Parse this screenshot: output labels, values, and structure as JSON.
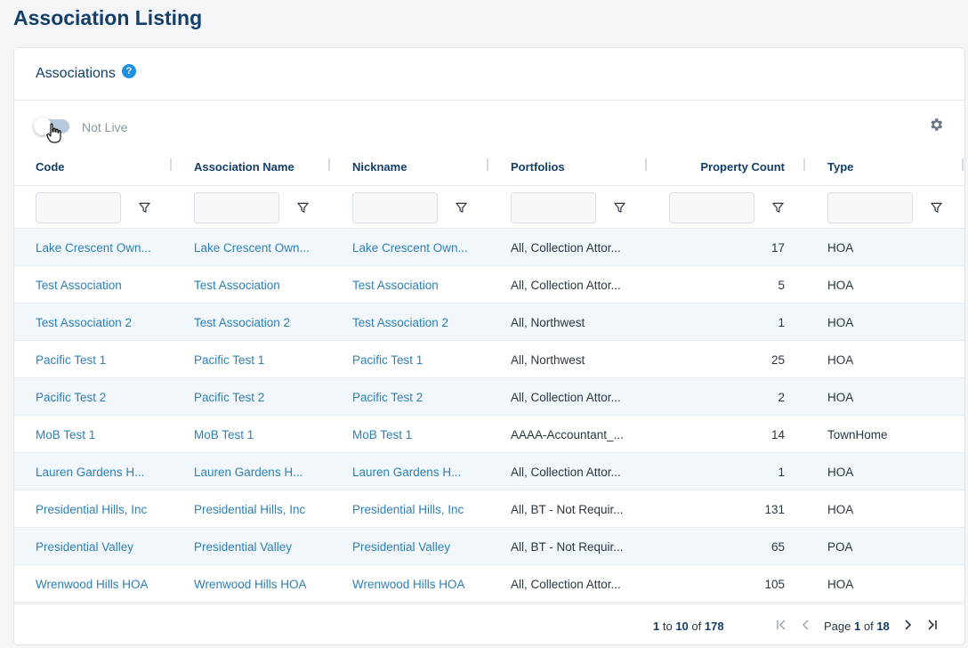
{
  "page": {
    "title": "Association Listing"
  },
  "card": {
    "title": "Associations",
    "help_glyph": "?"
  },
  "toolbar": {
    "toggle_label": "Not Live"
  },
  "columns": [
    {
      "label": "Code"
    },
    {
      "label": "Association Name"
    },
    {
      "label": "Nickname"
    },
    {
      "label": "Portfolios"
    },
    {
      "label": "Property Count"
    },
    {
      "label": "Type"
    }
  ],
  "rows": [
    {
      "code": "Lake Crescent Own...",
      "name": "Lake Crescent Own...",
      "nickname": "Lake Crescent Own...",
      "portfolios": "All, Collection Attor...",
      "count": "17",
      "type": "HOA"
    },
    {
      "code": "Test Association",
      "name": "Test Association",
      "nickname": "Test Association",
      "portfolios": "All, Collection Attor...",
      "count": "5",
      "type": "HOA"
    },
    {
      "code": "Test Association 2",
      "name": "Test Association 2",
      "nickname": "Test Association 2",
      "portfolios": "All, Northwest",
      "count": "1",
      "type": "HOA"
    },
    {
      "code": "Pacific Test 1",
      "name": "Pacific Test 1",
      "nickname": "Pacific Test 1",
      "portfolios": "All, Northwest",
      "count": "25",
      "type": "HOA"
    },
    {
      "code": "Pacific Test 2",
      "name": "Pacific Test 2",
      "nickname": "Pacific Test 2",
      "portfolios": "All, Collection Attor...",
      "count": "2",
      "type": "HOA"
    },
    {
      "code": "MoB Test 1",
      "name": "MoB Test 1",
      "nickname": "MoB Test 1",
      "portfolios": "AAAA-Accountant_...",
      "count": "14",
      "type": "TownHome"
    },
    {
      "code": "Lauren Gardens H...",
      "name": "Lauren Gardens H...",
      "nickname": "Lauren Gardens H...",
      "portfolios": "All, Collection Attor...",
      "count": "1",
      "type": "HOA"
    },
    {
      "code": "Presidential Hills, Inc",
      "name": "Presidential Hills, Inc",
      "nickname": "Presidential Hills, Inc",
      "portfolios": "All, BT - Not Requir...",
      "count": "131",
      "type": "HOA"
    },
    {
      "code": "Presidential Valley",
      "name": "Presidential Valley",
      "nickname": "Presidential Valley",
      "portfolios": "All, BT - Not Requir...",
      "count": "65",
      "type": "POA"
    },
    {
      "code": "Wrenwood Hills HOA",
      "name": "Wrenwood Hills HOA",
      "nickname": "Wrenwood Hills HOA",
      "portfolios": "All, Collection Attor...",
      "count": "105",
      "type": "HOA"
    }
  ],
  "pagination": {
    "range_start": "1",
    "range_to": "to",
    "range_end": "10",
    "of_label": "of",
    "total": "178",
    "page_label": "Page",
    "current_page": "1",
    "total_pages": "18"
  },
  "icons": {
    "help": "help-icon",
    "toggle": "toggle-switch",
    "cursor": "hand-pointer-icon",
    "settings": "gear-icon",
    "filter": "filter-icon",
    "first": "first-page-icon",
    "prev": "prev-page-icon",
    "next": "next-page-icon",
    "last": "last-page-icon"
  },
  "colors": {
    "title": "#123f6a",
    "link": "#2d7fb8",
    "accent": "#1e8fe1",
    "alt_row": "#f2f7fc"
  }
}
